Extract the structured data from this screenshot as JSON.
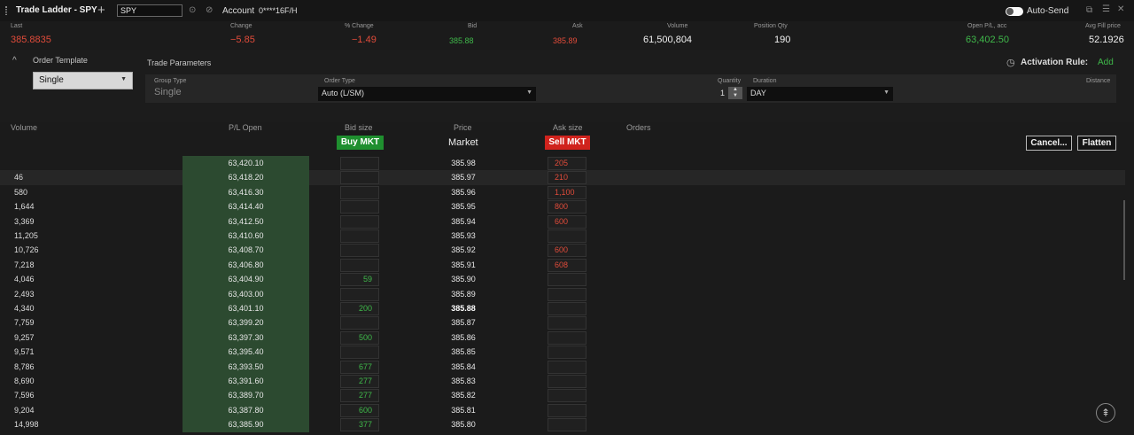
{
  "titlebar": {
    "title": "Trade Ladder - SPY",
    "symbol_value": "SPY",
    "account_label": "Account",
    "account_number": "0****16F/H",
    "autosend_label": "Auto-Send"
  },
  "quote": {
    "last_label": "Last",
    "last_value": "385.8835",
    "change_label": "Change",
    "change_value": "−5.85",
    "pct_change_label": "% Change",
    "pct_change_value": "−1.49",
    "bid_label": "Bid",
    "bid_value": "385.88",
    "ask_label": "Ask",
    "ask_value": "385.89",
    "volume_label": "Volume",
    "volume_value": "61,500,804",
    "position_label": "Position Qty",
    "position_value": "190",
    "open_pl_label": "Open P/L, acc",
    "open_pl_value": "63,402.50",
    "avg_fill_label": "Avg Fill price",
    "avg_fill_value": "52.1926"
  },
  "order_panel": {
    "order_template_label": "Order Template",
    "order_template_value": "Single",
    "trade_params_label": "Trade Parameters",
    "activation_rule_label": "Activation Rule:",
    "activation_rule_add": "Add",
    "group_type_label": "Group Type",
    "group_type_value": "Single",
    "order_type_label": "Order Type",
    "order_type_value": "Auto (L/SM)",
    "quantity_label": "Quantity",
    "quantity_value": "1",
    "duration_label": "Duration",
    "duration_value": "DAY",
    "distance_label": "Distance"
  },
  "ladder_header": {
    "volume": "Volume",
    "pl_open": "P/L Open",
    "bid_size": "Bid size",
    "price": "Price",
    "ask_size": "Ask size",
    "orders": "Orders",
    "buy_mkt": "Buy MKT",
    "market": "Market",
    "sell_mkt": "Sell MKT",
    "cancel": "Cancel...",
    "flatten": "Flatten"
  },
  "ladder_rows": [
    {
      "volume": "",
      "pl": "63,420.10",
      "bid": "",
      "price": "385.98",
      "ask": "205"
    },
    {
      "volume": "46",
      "pl": "63,418.20",
      "bid": "",
      "price": "385.97",
      "ask": "210"
    },
    {
      "volume": "580",
      "pl": "63,416.30",
      "bid": "",
      "price": "385.96",
      "ask": "1,100"
    },
    {
      "volume": "1,644",
      "pl": "63,414.40",
      "bid": "",
      "price": "385.95",
      "ask": "800"
    },
    {
      "volume": "3,369",
      "pl": "63,412.50",
      "bid": "",
      "price": "385.94",
      "ask": "600"
    },
    {
      "volume": "11,205",
      "pl": "63,410.60",
      "bid": "",
      "price": "385.93",
      "ask": ""
    },
    {
      "volume": "10,726",
      "pl": "63,408.70",
      "bid": "",
      "price": "385.92",
      "ask": "600"
    },
    {
      "volume": "7,218",
      "pl": "63,406.80",
      "bid": "",
      "price": "385.91",
      "ask": "608"
    },
    {
      "volume": "4,046",
      "pl": "63,404.90",
      "bid": "59",
      "price": "385.90",
      "ask": ""
    },
    {
      "volume": "2,493",
      "pl": "63,403.00",
      "bid": "",
      "price": "385.89",
      "ask": ""
    },
    {
      "volume": "4,340",
      "pl": "63,401.10",
      "bid": "200",
      "price": "385.88",
      "ask": ""
    },
    {
      "volume": "7,759",
      "pl": "63,399.20",
      "bid": "",
      "price": "385.87",
      "ask": ""
    },
    {
      "volume": "9,257",
      "pl": "63,397.30",
      "bid": "500",
      "price": "385.86",
      "ask": ""
    },
    {
      "volume": "9,571",
      "pl": "63,395.40",
      "bid": "",
      "price": "385.85",
      "ask": ""
    },
    {
      "volume": "8,786",
      "pl": "63,393.50",
      "bid": "677",
      "price": "385.84",
      "ask": ""
    },
    {
      "volume": "8,690",
      "pl": "63,391.60",
      "bid": "277",
      "price": "385.83",
      "ask": ""
    },
    {
      "volume": "7,596",
      "pl": "63,389.70",
      "bid": "277",
      "price": "385.82",
      "ask": ""
    },
    {
      "volume": "9,204",
      "pl": "63,387.80",
      "bid": "600",
      "price": "385.81",
      "ask": ""
    },
    {
      "volume": "14,998",
      "pl": "63,385.90",
      "bid": "377",
      "price": "385.80",
      "ask": ""
    }
  ],
  "colors": {
    "buy": "#1f8f2f",
    "sell": "#d0231d",
    "positive": "#3fb84a",
    "negative": "#e04b3a",
    "pl_column": "#2c4a30"
  },
  "icons": [
    "drag-grip-icon",
    "add-tab-icon",
    "settings-circle-icon",
    "link-icon",
    "toggle-switch",
    "popout-icon",
    "list-menu-icon",
    "close-icon",
    "collapse-chevron-icon",
    "clock-icon",
    "dropdown-caret-icon",
    "ladder-recenter-icon"
  ]
}
